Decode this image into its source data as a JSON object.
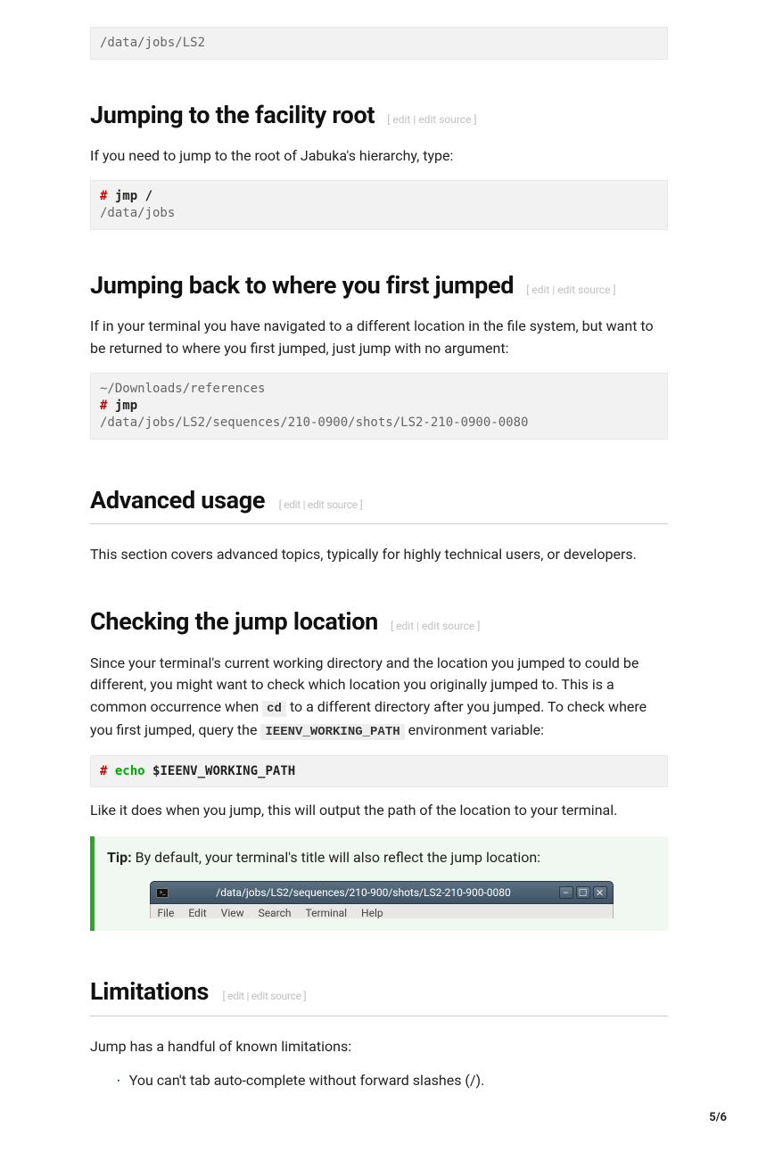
{
  "code_block_1": "/data/jobs/LS2",
  "section_root": {
    "heading": "Jumping to the facility root",
    "edit": "edit",
    "edit_source": "edit source",
    "para": "If you need to jump to the root of Jabuka's hierarchy, type:",
    "hash": "#",
    "cmd": "jmp /",
    "out": "/data/jobs"
  },
  "section_back": {
    "heading": "Jumping back to where you first jumped",
    "edit": "edit",
    "edit_source": "edit source",
    "para": "If in your terminal you have navigated to a different location in the file system, but want to be returned to where you first jumped, just jump with no argument:",
    "pre1": "~/Downloads/references",
    "hash": "#",
    "cmd": "jmp",
    "out": "/data/jobs/LS2/sequences/210-0900/shots/LS2-210-0900-0080"
  },
  "section_adv": {
    "heading": "Advanced usage",
    "edit": "edit",
    "edit_source": "edit source",
    "para": "This section covers advanced topics, typically for highly technical users, or developers."
  },
  "section_check": {
    "heading": "Checking the jump location",
    "edit": "edit",
    "edit_source": "edit source",
    "para_a": "Since your terminal's current working directory and the location you jumped to could be different, you might want to check which location you originally jumped to. This is a common occurrence when ",
    "code_cd": "cd",
    "para_b": " to a different directory after you jumped. To check where you first jumped, query the ",
    "code_env": "IEENV_WORKING_PATH",
    "para_c": " environment variable:",
    "hash": "#",
    "kw": "echo",
    "arg": "$IEENV_WORKING_PATH",
    "para_after": "Like it does when you jump, this will output the path of the location to your terminal.",
    "tip_label": "Tip:",
    "tip_text": " By default, your terminal's title will also reflect the jump location:",
    "term_title": "/data/jobs/LS2/sequences/210-900/shots/LS2-210-900-0080",
    "menu": {
      "file": "File",
      "edit": "Edit",
      "view": "View",
      "search": "Search",
      "terminal": "Terminal",
      "help": "Help"
    },
    "winbtn_min": "–",
    "winbtn_max": "☐",
    "winbtn_close": "✕"
  },
  "section_lim": {
    "heading": "Limitations",
    "edit": "edit",
    "edit_source": "edit source",
    "para": "Jump has a handful of known limitations:",
    "item1": "You can't tab auto-complete without forward slashes (/)."
  },
  "page_num": "5/6"
}
